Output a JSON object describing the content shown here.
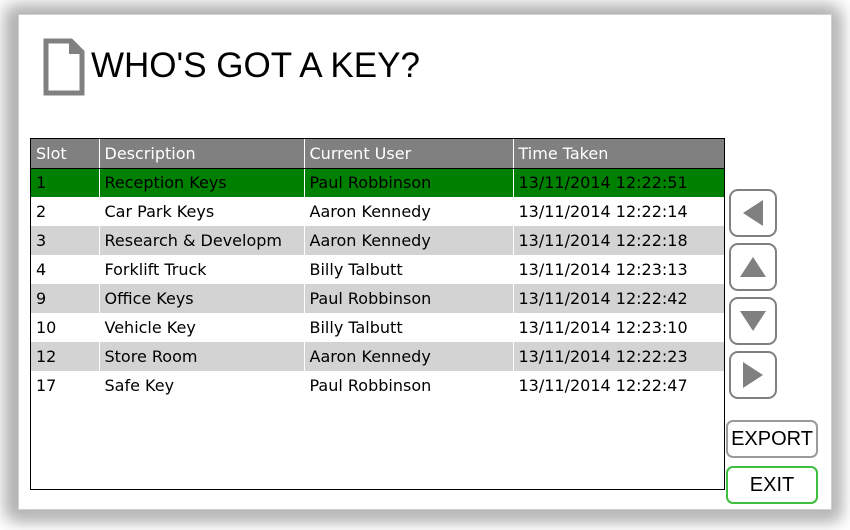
{
  "window": {
    "title": "WHO'S GOT A KEY?",
    "icon": "document-icon"
  },
  "table": {
    "columns": [
      {
        "key": "slot",
        "label": "Slot"
      },
      {
        "key": "description",
        "label": "Description"
      },
      {
        "key": "current_user",
        "label": "Current User"
      },
      {
        "key": "time_taken",
        "label": "Time Taken"
      }
    ],
    "rows": [
      {
        "slot": "1",
        "description": "Reception Keys",
        "current_user": "Paul Robbinson",
        "time_taken": "13/11/2014 12:22:51",
        "selected": true
      },
      {
        "slot": "2",
        "description": "Car Park Keys",
        "current_user": "Aaron Kennedy",
        "time_taken": "13/11/2014 12:22:14",
        "selected": false
      },
      {
        "slot": "3",
        "description": "Research & Developm",
        "current_user": "Aaron Kennedy",
        "time_taken": "13/11/2014 12:22:18",
        "selected": false
      },
      {
        "slot": "4",
        "description": "Forklift Truck",
        "current_user": "Billy  Talbutt",
        "time_taken": "13/11/2014 12:23:13",
        "selected": false
      },
      {
        "slot": "9",
        "description": "Office Keys",
        "current_user": "Paul Robbinson",
        "time_taken": "13/11/2014 12:22:42",
        "selected": false
      },
      {
        "slot": "10",
        "description": "Vehicle Key",
        "current_user": "Billy  Talbutt",
        "time_taken": "13/11/2014 12:23:10",
        "selected": false
      },
      {
        "slot": "12",
        "description": "Store Room",
        "current_user": "Aaron Kennedy",
        "time_taken": "13/11/2014 12:22:23",
        "selected": false
      },
      {
        "slot": "17",
        "description": "Safe Key",
        "current_user": "Paul Robbinson",
        "time_taken": "13/11/2014 12:22:47",
        "selected": false
      }
    ]
  },
  "side_panel": {
    "nav": [
      {
        "name": "page-left-button",
        "icon": "triangle-left-icon"
      },
      {
        "name": "scroll-up-button",
        "icon": "triangle-up-icon"
      },
      {
        "name": "scroll-down-button",
        "icon": "triangle-down-icon"
      },
      {
        "name": "page-right-button",
        "icon": "triangle-right-icon"
      }
    ],
    "export_label": "EXPORT",
    "exit_label": "EXIT"
  },
  "colors": {
    "header_gray": "#808080",
    "row_gray": "#d3d3d3",
    "row_white": "#ffffff",
    "selected_green": "#008000",
    "exit_border_green": "#3fbf3f",
    "icon_gray": "#808080",
    "window_bg": "#ffffff"
  }
}
